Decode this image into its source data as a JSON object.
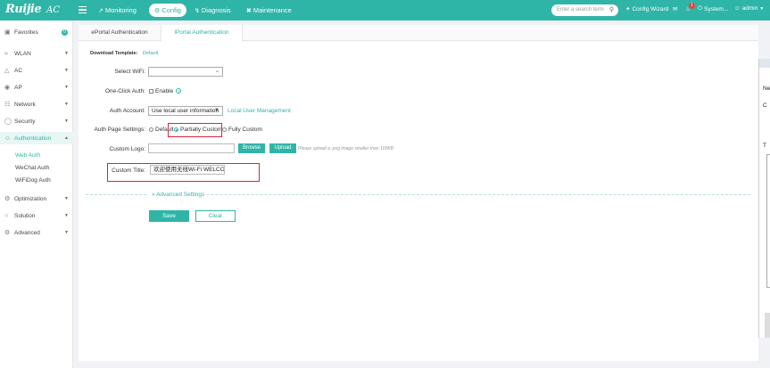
{
  "brand": {
    "logo": "Ruijie",
    "product": "AC"
  },
  "topnav": {
    "monitoring": "Monitoring",
    "config": "Config",
    "diagnosis": "Diagnosis",
    "maintenance": "Maintenance"
  },
  "topbar": {
    "search_placeholder": "Enter a search term",
    "config_wizard": "Config Wizard",
    "notification_count": "1",
    "system": "System...",
    "admin": "admin"
  },
  "sidebar": {
    "favorites": {
      "label": "Favorites",
      "count": "0"
    },
    "items": [
      "WLAN",
      "AC",
      "AP",
      "Network",
      "Security",
      "Authentication",
      "Optimization",
      "Solution",
      "Advanced"
    ],
    "auth_sub": [
      "Web Auth",
      "WeChat Auth",
      "WiFiDog Auth"
    ]
  },
  "tabs": [
    "ePortal Authentication",
    "iPortal Authentication"
  ],
  "form": {
    "download_label": "Download Template:",
    "download_link": "Default",
    "select_wifi_label": "Select WiFi:",
    "select_wifi_value": "",
    "one_click_label": "One-Click Auth:",
    "one_click_option": "Enable",
    "auth_account_label": "Auth Account:",
    "auth_account_value": "Use local user information",
    "local_user_link": "Local User Management",
    "page_settings_label": "Auth Page Settings:",
    "page_settings_options": [
      "Default",
      "Partially Custom",
      "Fully Custom"
    ],
    "page_settings_selected": "Partially Custom",
    "custom_logo_label": "Custom Logo:",
    "browse": "Browse",
    "upload": "Upload",
    "upload_hint": "Please upload a .png image smaller than 100KB",
    "custom_title_label": "Custom Title:",
    "custom_title_value": "欢迎使用无线Wi-Fi WELCOME",
    "advanced_settings": "Advanced Settings",
    "save": "Save",
    "clear": "Clear"
  },
  "colors": {
    "accent": "#2fb5a7",
    "highlight": "#d8263c"
  }
}
